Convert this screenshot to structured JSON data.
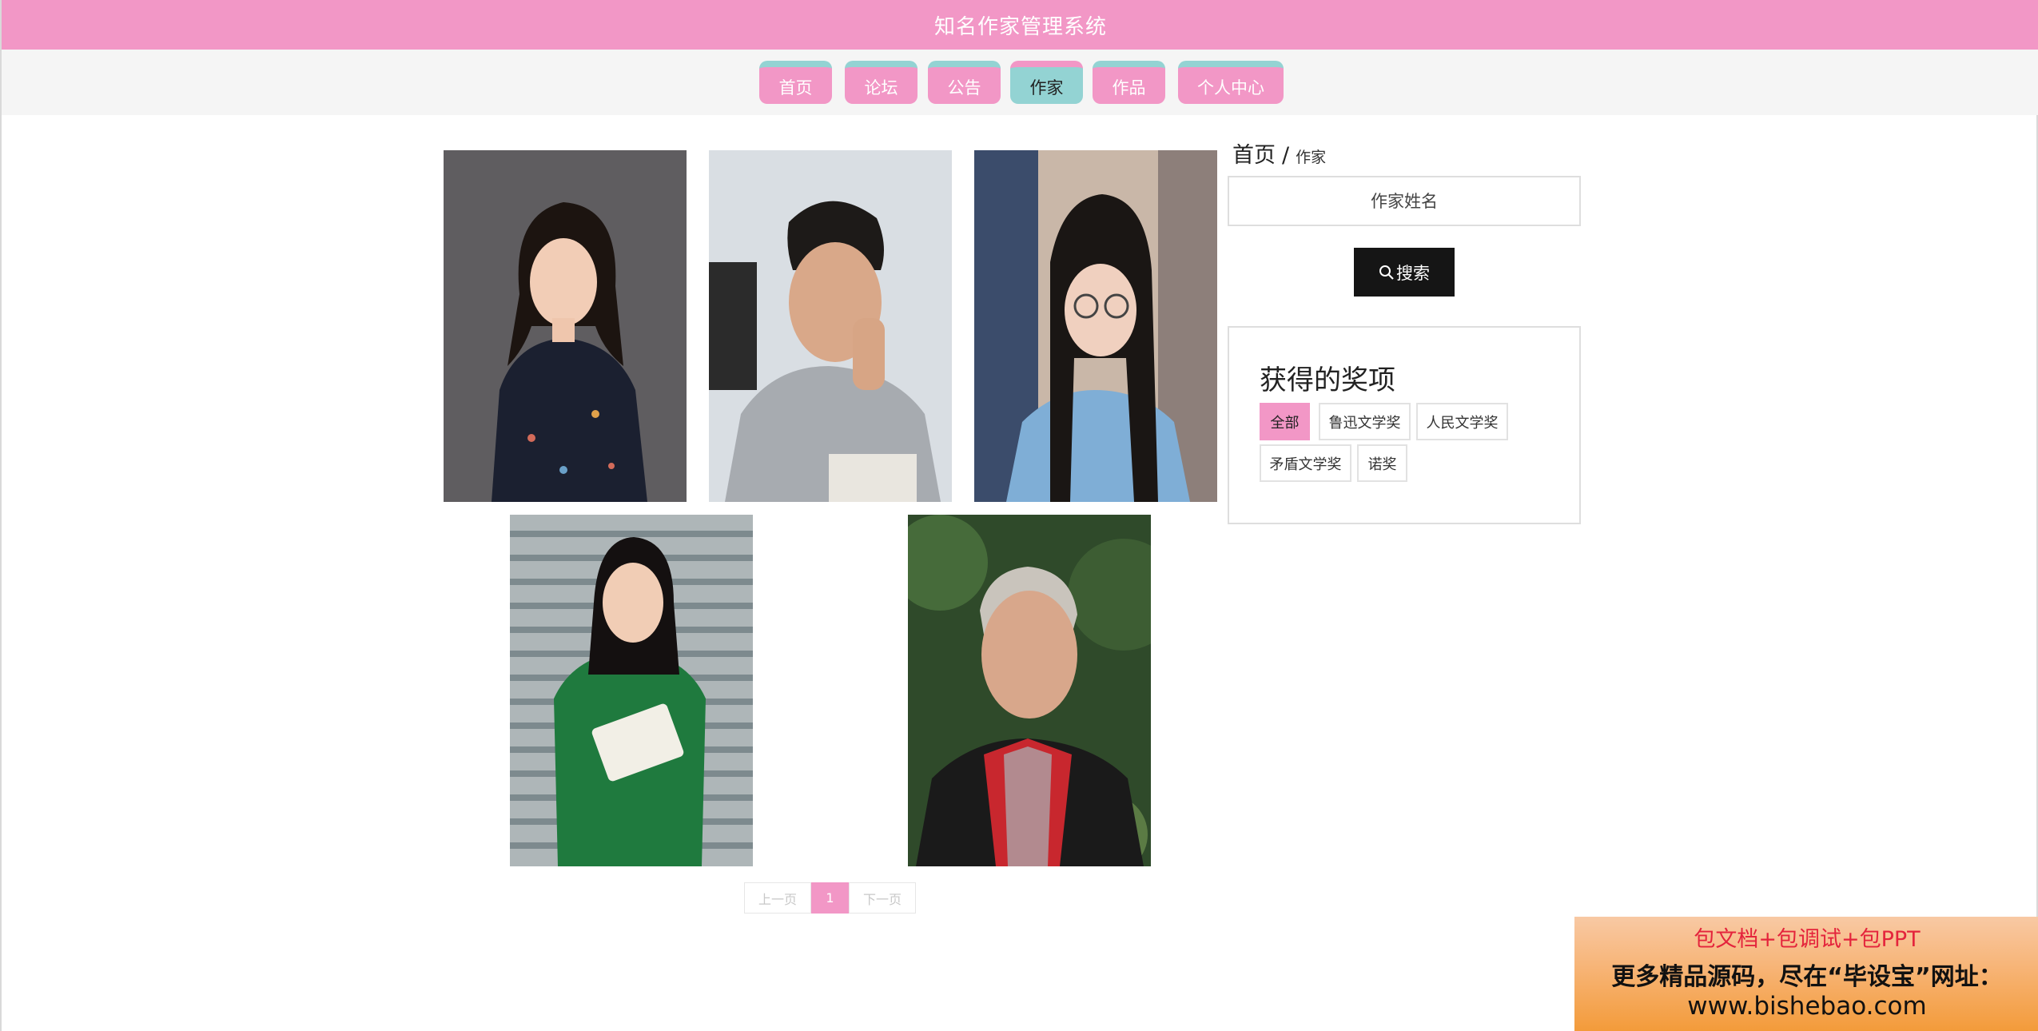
{
  "header": {
    "title": "知名作家管理系统"
  },
  "nav": {
    "items": [
      {
        "label": "首页"
      },
      {
        "label": "论坛"
      },
      {
        "label": "公告"
      },
      {
        "label": "作家",
        "active": true
      },
      {
        "label": "作品"
      },
      {
        "label": "个人中心"
      }
    ]
  },
  "breadcrumb": {
    "home": "首页",
    "separator": "/",
    "current": "作家"
  },
  "search": {
    "placeholder": "作家姓名",
    "button_label": "搜索",
    "button_icon": "search-icon"
  },
  "awards": {
    "title": "获得的奖项",
    "tags": [
      {
        "label": "全部",
        "active": true
      },
      {
        "label": "鲁迅文学奖"
      },
      {
        "label": "人民文学奖"
      },
      {
        "label": "矛盾文学奖"
      },
      {
        "label": "诺奖"
      }
    ]
  },
  "pagination": {
    "prev": "上一页",
    "current": "1",
    "next": "下一页"
  },
  "promo": {
    "line1": "包文档+包调试+包PPT",
    "line2": "更多精品源码，尽在“毕设宝”网址：",
    "line3": "www.bishebao.com"
  },
  "colors": {
    "accent": "#f297c6",
    "teal": "#93d3d3",
    "dark_button": "#151515"
  }
}
